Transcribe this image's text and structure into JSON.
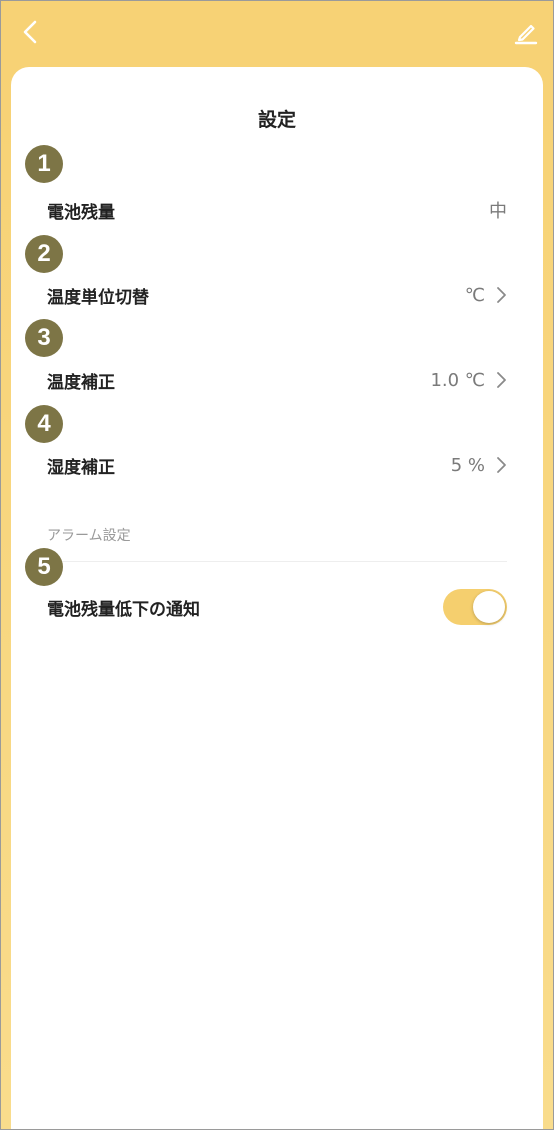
{
  "header": {
    "title": "設定"
  },
  "rows": [
    {
      "badge": "1",
      "label": "電池残量",
      "value": "中",
      "has_chevron": false
    },
    {
      "badge": "2",
      "label": "温度単位切替",
      "value": "℃",
      "has_chevron": true
    },
    {
      "badge": "3",
      "label": "温度補正",
      "value": "1.0 ℃",
      "has_chevron": true
    },
    {
      "badge": "4",
      "label": "湿度補正",
      "value": "5 %",
      "has_chevron": true
    }
  ],
  "alarm": {
    "section_title": "アラーム設定",
    "badge": "5",
    "label": "電池残量低下の通知",
    "toggle_on": true
  },
  "icons": {
    "back": "chevron-left-icon",
    "edit": "pencil-icon",
    "row_arrow": "chevron-right-icon"
  },
  "colors": {
    "header_bg": "#f7d275",
    "badge_bg": "#7d7546",
    "toggle_on": "#f5cf6e"
  }
}
